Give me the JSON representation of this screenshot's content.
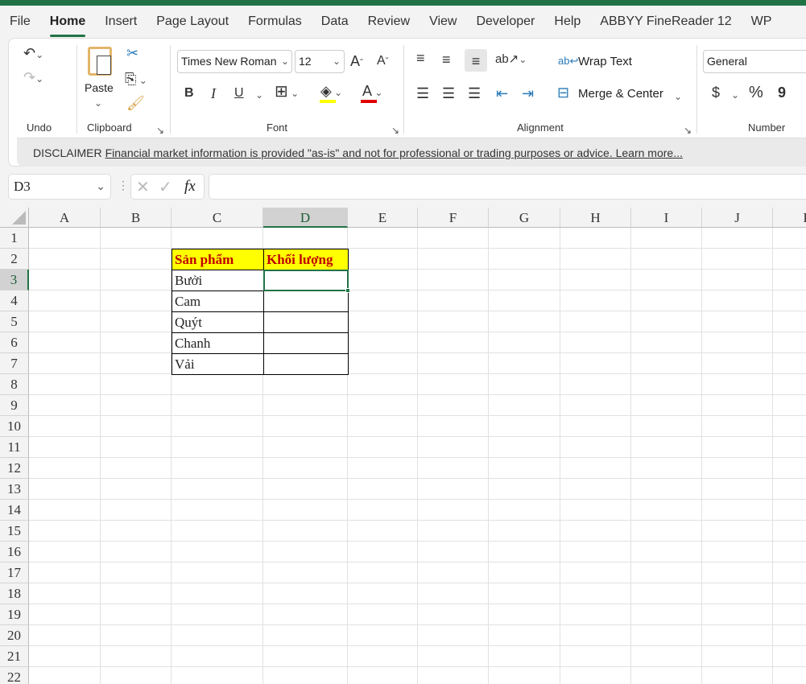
{
  "tabs": [
    "File",
    "Home",
    "Insert",
    "Page Layout",
    "Formulas",
    "Data",
    "Review",
    "View",
    "Developer",
    "Help",
    "ABBYY FineReader 12",
    "WP"
  ],
  "active_tab": "Home",
  "ribbon": {
    "undo_label": "Undo",
    "clipboard_label": "Clipboard",
    "paste_label": "Paste",
    "font_label": "Font",
    "font_name": "Times New Roman",
    "font_size": "12",
    "bold": "B",
    "italic": "I",
    "underline": "U",
    "alignment_label": "Alignment",
    "wrap_text": "Wrap Text",
    "merge_center": "Merge & Center",
    "number_label": "Number",
    "number_format": "General",
    "currency": "$",
    "percent": "%",
    "comma": "9",
    "fill_color": "#ffff00",
    "font_color": "#e00000"
  },
  "disclaimer": {
    "label": "DISCLAIMER",
    "text": "Financial market information is provided \"as-is\" and not for professional or trading purposes or advice. Learn more..."
  },
  "formula_bar": {
    "name_box": "D3",
    "fx": "fx",
    "value": ""
  },
  "sheet": {
    "columns": [
      "A",
      "B",
      "C",
      "D",
      "E",
      "F",
      "G",
      "H",
      "I",
      "J",
      "K"
    ],
    "rows": 22,
    "selected_cell": "D3",
    "cells": {
      "C2": "Sản phẩm",
      "D2": "Khối lượng",
      "C3": "Bưởi",
      "C4": "Cam",
      "C5": "Quýt",
      "C6": "Chanh",
      "C7": "Vải"
    },
    "header_fill": "#ffff00",
    "header_text_color": "#c00000",
    "accent": "#217346"
  }
}
